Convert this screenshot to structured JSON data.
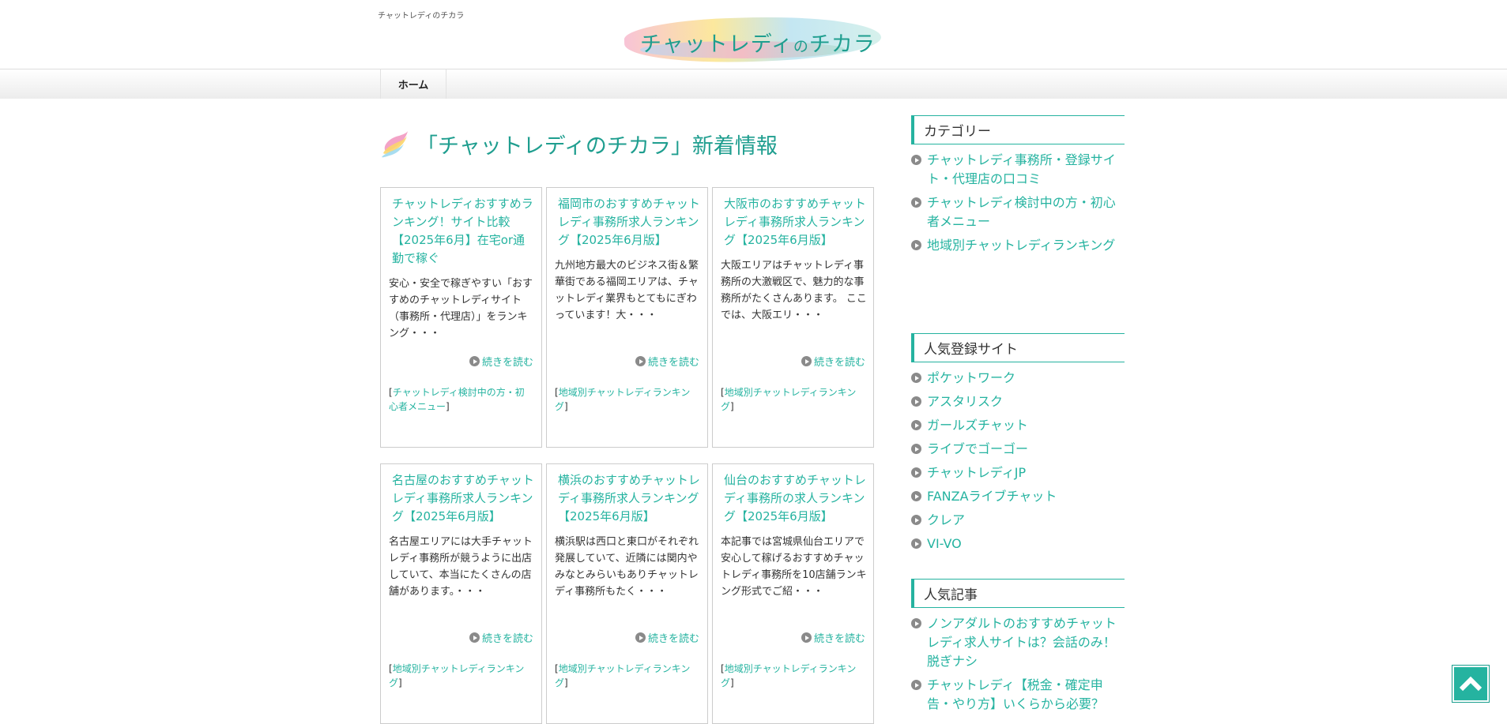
{
  "header": {
    "tagline": "チャットレディのチカラ",
    "logo_text_1": "チャットレディ",
    "logo_text_2": "の",
    "logo_text_3": "チカラ"
  },
  "nav": {
    "home": "ホーム"
  },
  "main": {
    "title": "「チャットレディのチカラ」新着情報",
    "cards": [
      {
        "title": "チャットレディおすすめランキング！サイト比較【2025年6月】在宅or通勤で稼ぐ",
        "excerpt": " 安心・安全で稼ぎやすい「おすすめのチャットレディサイト（事務所・代理店）」をランキング・・・",
        "more": "続きを読む",
        "category": "チャットレディ検討中の方・初心者メニュー"
      },
      {
        "title": "福岡市のおすすめチャットレディ事務所求人ランキング【2025年6月版】",
        "excerpt": "九州地方最大のビジネス街＆繁華街である福岡エリアは、チャットレディ業界もとてもにぎわっています！大・・・",
        "more": "続きを読む",
        "category": "地域別チャットレディランキング"
      },
      {
        "title": "大阪市のおすすめチャットレディ事務所求人ランキング【2025年6月版】",
        "excerpt": "大阪エリアはチャットレディ事務所の大激戦区で、魅力的な事務所がたくさんあります。 ここでは、大阪エリ・・・",
        "more": "続きを読む",
        "category": "地域別チャットレディランキング"
      },
      {
        "title": "名古屋のおすすめチャットレディ事務所求人ランキング【2025年6月版】",
        "excerpt": "名古屋エリアには大手チャットレディ事務所が競うように出店していて、本当にたくさんの店舗があります。・・・",
        "more": "続きを読む",
        "category": "地域別チャットレディランキング"
      },
      {
        "title": "横浜のおすすめチャットレディ事務所求人ランキング【2025年6月版】",
        "excerpt": "横浜駅は西口と東口がそれぞれ発展していて、近隣には関内やみなとみらいもありチャットレディ事務所もたく・・・",
        "more": "続きを読む",
        "category": "地域別チャットレディランキング"
      },
      {
        "title": "仙台のおすすめチャットレディ事務所の求人ランキング【2025年6月版】",
        "excerpt": "本記事では宮城県仙台エリアで安心して稼げるおすすめチャットレディ事務所を10店舗ランキング形式でご紹・・・",
        "more": "続きを読む",
        "category": "地域別チャットレディランキング"
      }
    ]
  },
  "sidebar": {
    "categories": {
      "heading": "カテゴリー",
      "items": [
        "チャットレディ事務所・登録サイト・代理店の口コミ",
        "チャットレディ検討中の方・初心者メニュー",
        "地域別チャットレディランキング"
      ]
    },
    "popular_sites": {
      "heading": "人気登録サイト",
      "items": [
        "ポケットワーク",
        "アスタリスク",
        "ガールズチャット",
        "ライブでゴーゴー",
        "チャットレディJP",
        "FANZAライブチャット",
        "クレア",
        "VI-VO"
      ]
    },
    "popular_articles": {
      "heading": "人気記事",
      "items": [
        "ノンアダルトのおすすめチャットレディ求人サイトは？会話のみ！脱ぎナシ",
        "チャットレディ【税金・確定申告・やり方】いくらから必要？"
      ]
    }
  },
  "icons": {
    "back_to_top": "chevron-up-icon",
    "list_bullet": "arrow-circle-icon"
  },
  "colors": {
    "accent": "#25b3a0",
    "text": "#333333"
  }
}
